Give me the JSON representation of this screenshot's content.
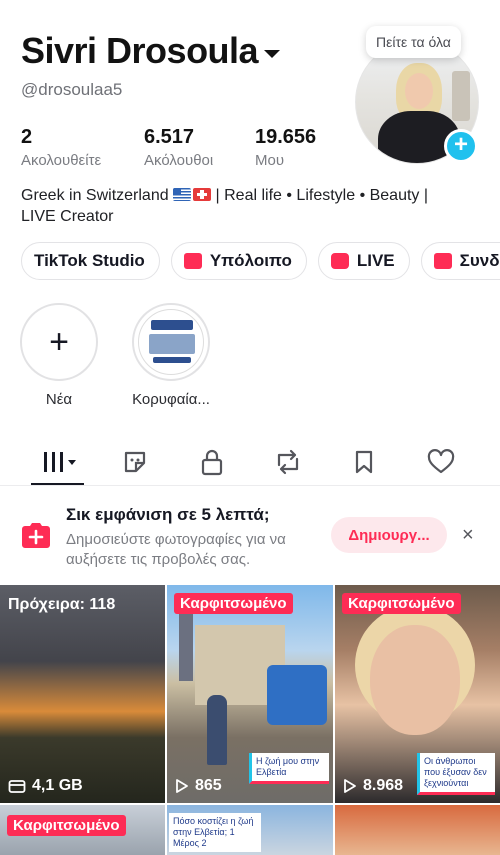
{
  "profile": {
    "display_name": "Sivri Drosoula",
    "username": "@drosoulaa5",
    "avatar_tooltip": "Πείτε τα όλα",
    "stats": [
      {
        "value": "2",
        "label": "Ακολουθείτε"
      },
      {
        "value": "6.517",
        "label": "Ακόλουθοι"
      },
      {
        "value": "19.656",
        "label": "Μου"
      }
    ],
    "bio_part1": "Greek in Switzerland",
    "bio_part2": " | Real life • Lifestyle • Beauty |",
    "bio_line2": "LIVE Creator"
  },
  "chips": [
    {
      "label": "TikTok Studio",
      "icon": "person-icon"
    },
    {
      "label": "Υπόλοιπο",
      "icon": "wallet-icon"
    },
    {
      "label": "LIVE",
      "icon": "live-icon"
    },
    {
      "label": "Συνδρ",
      "icon": "subscription-icon"
    }
  ],
  "highlights": [
    {
      "label": "Νέα"
    },
    {
      "label": "Κορυφαία..."
    }
  ],
  "tabs": [
    "videos-tab",
    "reposts-stickers-tab",
    "private-tab",
    "reposts-tab",
    "saved-tab",
    "liked-tab"
  ],
  "promo": {
    "title": "Σικ εμφάνιση σε 5 λεπτά;",
    "body": "Δημοσιεύστε φωτογραφίες για να αυξήσετε τις προβολές σας.",
    "button": "Δημιουργ...",
    "close": "×"
  },
  "grid": {
    "drafts_label": "Πρόχειρα: 118",
    "drafts_size": "4,1 GB",
    "pinned_label": "Καρφιτσωμένο",
    "items": [
      {
        "views": "865",
        "caption": "Η ζωή μου στην Ελβετία"
      },
      {
        "views": "8.968",
        "caption": "Οι άνθρωποι που έξυσαν δεν ξεχνιούνται"
      },
      {
        "caption": "Πόσο κοστίζει η ζωή στην Ελβετία; 1 Μέρος 2"
      }
    ]
  },
  "colors": {
    "accent": "#fe2c55",
    "badge_blue": "#20c1ee",
    "text": "#161823",
    "muted": "#7a7c82"
  }
}
